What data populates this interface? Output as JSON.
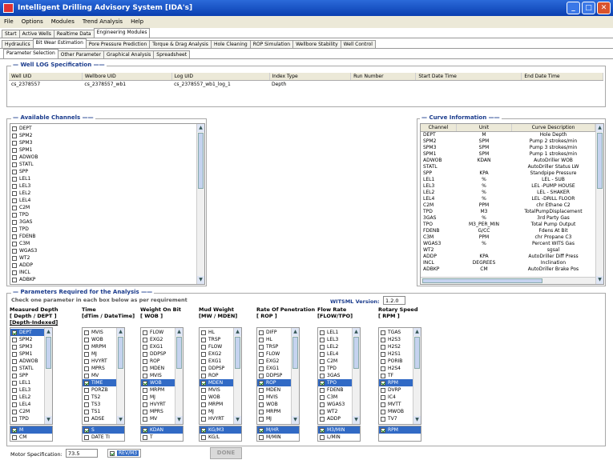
{
  "window": {
    "title": "Intelligent Drilling Advisory System  [IDA's]"
  },
  "menu": [
    "File",
    "Options",
    "Modules",
    "Trend Analysis",
    "Help"
  ],
  "tabs_main": [
    "Start",
    "Active Wells",
    "Realtime Data",
    "Engineering Modules"
  ],
  "tabs_modules": [
    "Hydraulics",
    "Bit Wear Estimation",
    "Pore Pressure Prediction",
    "Torque & Drag Analysis",
    "Hole Cleaning",
    "ROP Simulation",
    "Wellbore Stability",
    "Well Control"
  ],
  "tabs_sub": [
    "Parameter Selection",
    "Other Parameter",
    "Graphical Analysis",
    "Spreadsheet"
  ],
  "well_log": {
    "title": "Well LOG Specification",
    "columns": [
      "Well UID",
      "Wellbore UID",
      "Log UID",
      "Index Type",
      "Run Number",
      "Start Date Time",
      "End Date Time"
    ],
    "row": [
      "cs_2378557",
      "cs_2378557_wb1",
      "cs_2378557_wb1_log_1",
      "Depth",
      "",
      "",
      ""
    ]
  },
  "channels": {
    "title": "Available Channels",
    "items": [
      "DEPT",
      "SPM2",
      "SPM3",
      "SPM1",
      "ADWOB",
      "STATL",
      "SPP",
      "LEL1",
      "LEL3",
      "LEL2",
      "LEL4",
      "C2M",
      "TPD",
      "3GAS",
      "TPD",
      "FDENB",
      "C3M",
      "WGAS3",
      "WT2",
      "ADDP",
      "INCL",
      "ADBKP",
      "ADRSP"
    ]
  },
  "curve_info": {
    "title": "Curve Information",
    "columns": [
      "Channel",
      "Unit",
      "Curve Description"
    ],
    "rows": [
      [
        "DEPT",
        "M",
        "Hole Depth"
      ],
      [
        "SPM2",
        "SPM",
        "Pump 2 strokes/min"
      ],
      [
        "SPM3",
        "SPM",
        "Pump 3 strokes/min"
      ],
      [
        "SPM1",
        "SPM",
        "Pump 1 strokes/min"
      ],
      [
        "ADWOB",
        "KDAN",
        "AutoDriller WOB"
      ],
      [
        "STATL",
        "",
        "AutoDriller Status LW"
      ],
      [
        "SPP",
        "KPA",
        "Standpipe Pressure"
      ],
      [
        "LEL1",
        "%",
        "LEL - SUB"
      ],
      [
        "LEL3",
        "%",
        "LEL -PUMP HOUSE"
      ],
      [
        "LEL2",
        "%",
        "LEL - SHAKER"
      ],
      [
        "LEL4",
        "%",
        "LEL -DRILL FLOOR"
      ],
      [
        "C2M",
        "PPM",
        "chr Ethane C2"
      ],
      [
        "TPD",
        "M3",
        "TotalPumpDisplacement"
      ],
      [
        "3GAS",
        "%",
        "3rd Party Gas"
      ],
      [
        "TPO",
        "M3_PER_MIN",
        "Total Pump Output"
      ],
      [
        "FDENB",
        "G/CC",
        "Fdens At Bit"
      ],
      [
        "C3M",
        "PPM",
        "chr Propane C3"
      ],
      [
        "WGAS3",
        "%",
        "Percent WITS Gas"
      ],
      [
        "WT2",
        "",
        "sgsal"
      ],
      [
        "ADDP",
        "KPA",
        "AutoDriller Diff Press"
      ],
      [
        "INCL",
        "DEGREES",
        "Inclination"
      ],
      [
        "ADBKP",
        "CM",
        "AutoDriller Brake Pos"
      ]
    ]
  },
  "params": {
    "title": "Parameters Required for the Analysis",
    "subtitle": "Check one parameter in each box below as per requirement",
    "witsml_label": "WITSML Version:",
    "witsml_value": "1.2.0",
    "columns": [
      {
        "h1": "Measured Depth",
        "h2": "[ Depth / DEPT ]",
        "h3": "[Depth-Indexed]",
        "items": [
          "DEPT",
          "SPM2",
          "SPM3",
          "SPM1",
          "ADWOB",
          "STATL",
          "SPP",
          "LEL1",
          "LEL3",
          "LEL2",
          "LEL4",
          "C2M",
          "TPD"
        ],
        "checked": 0,
        "units": [
          "M",
          "CM"
        ],
        "unit_sel": 0
      },
      {
        "h1": "Time",
        "h2": "[dTim / DateTime]",
        "h3": "",
        "items": [
          "MVIS",
          "WOB",
          "MRPM",
          "MJ",
          "HVYRT",
          "MPRS",
          "MV",
          "TIME",
          "PORZB",
          "TS2",
          "TS3",
          "TS1",
          "ADSE"
        ],
        "checked": 7,
        "units": [
          "S",
          "DATE TI"
        ],
        "unit_sel": 0
      },
      {
        "h1": "Weight On Bit",
        "h2": "[ WOB ]",
        "h3": "",
        "items": [
          "FLOW",
          "EXG2",
          "EXG1",
          "DDPSP",
          "ROP",
          "MDEN",
          "MVIS",
          "WOB",
          "MRPM",
          "MJ",
          "HVYRT",
          "MPRS",
          "MV"
        ],
        "checked": 7,
        "units": [
          "KDAN",
          "T"
        ],
        "unit_sel": 0
      },
      {
        "h1": "Mud Weight",
        "h2": "[MW / MDEN]",
        "h3": "",
        "items": [
          "HL",
          "TRSP",
          "FLOW",
          "EXG2",
          "EXG1",
          "DDPSP",
          "ROP",
          "MDEN",
          "MVIS",
          "WOB",
          "MRPM",
          "MJ",
          "HVYRT"
        ],
        "checked": 7,
        "units": [
          "KG/M3",
          "KG/L"
        ],
        "unit_sel": 0
      },
      {
        "h1": "Rate Of Penetration",
        "h2": "[ ROP ]",
        "h3": "",
        "items": [
          "DIFP",
          "HL",
          "TRSP",
          "FLOW",
          "EXG2",
          "EXG1",
          "DDPSP",
          "ROP",
          "MDEN",
          "MVIS",
          "WOB",
          "MRPM",
          "MJ"
        ],
        "checked": 7,
        "units": [
          "M/HR",
          "M/MIN"
        ],
        "unit_sel": 0
      },
      {
        "h1": "Flow Rate",
        "h2": "[FLOW/TPO]",
        "h3": "",
        "items": [
          "LEL1",
          "LEL3",
          "LEL2",
          "LEL4",
          "C2M",
          "TPD",
          "3GAS",
          "TPO",
          "FDENB",
          "C3M",
          "WGAS3",
          "WT2",
          "ADDP"
        ],
        "checked": 7,
        "units": [
          "M3/MIN",
          "L/MIN"
        ],
        "unit_sel": 0
      },
      {
        "h1": "Rotary Speed",
        "h2": "[ RPM ]",
        "h3": "",
        "items": [
          "TGAS",
          "H2S3",
          "H2S2",
          "H2S1",
          "PORIB",
          "H2S4",
          "TF",
          "RPM",
          "DVRP",
          "IC4",
          "MVTT",
          "MWOB",
          "TV7"
        ],
        "checked": 7,
        "units": [
          "RPM"
        ],
        "unit_sel": 0
      }
    ]
  },
  "motor": {
    "label": "Motor Specification:",
    "value": "73.5",
    "unit": "REV/M3"
  },
  "done_button": "DONE"
}
